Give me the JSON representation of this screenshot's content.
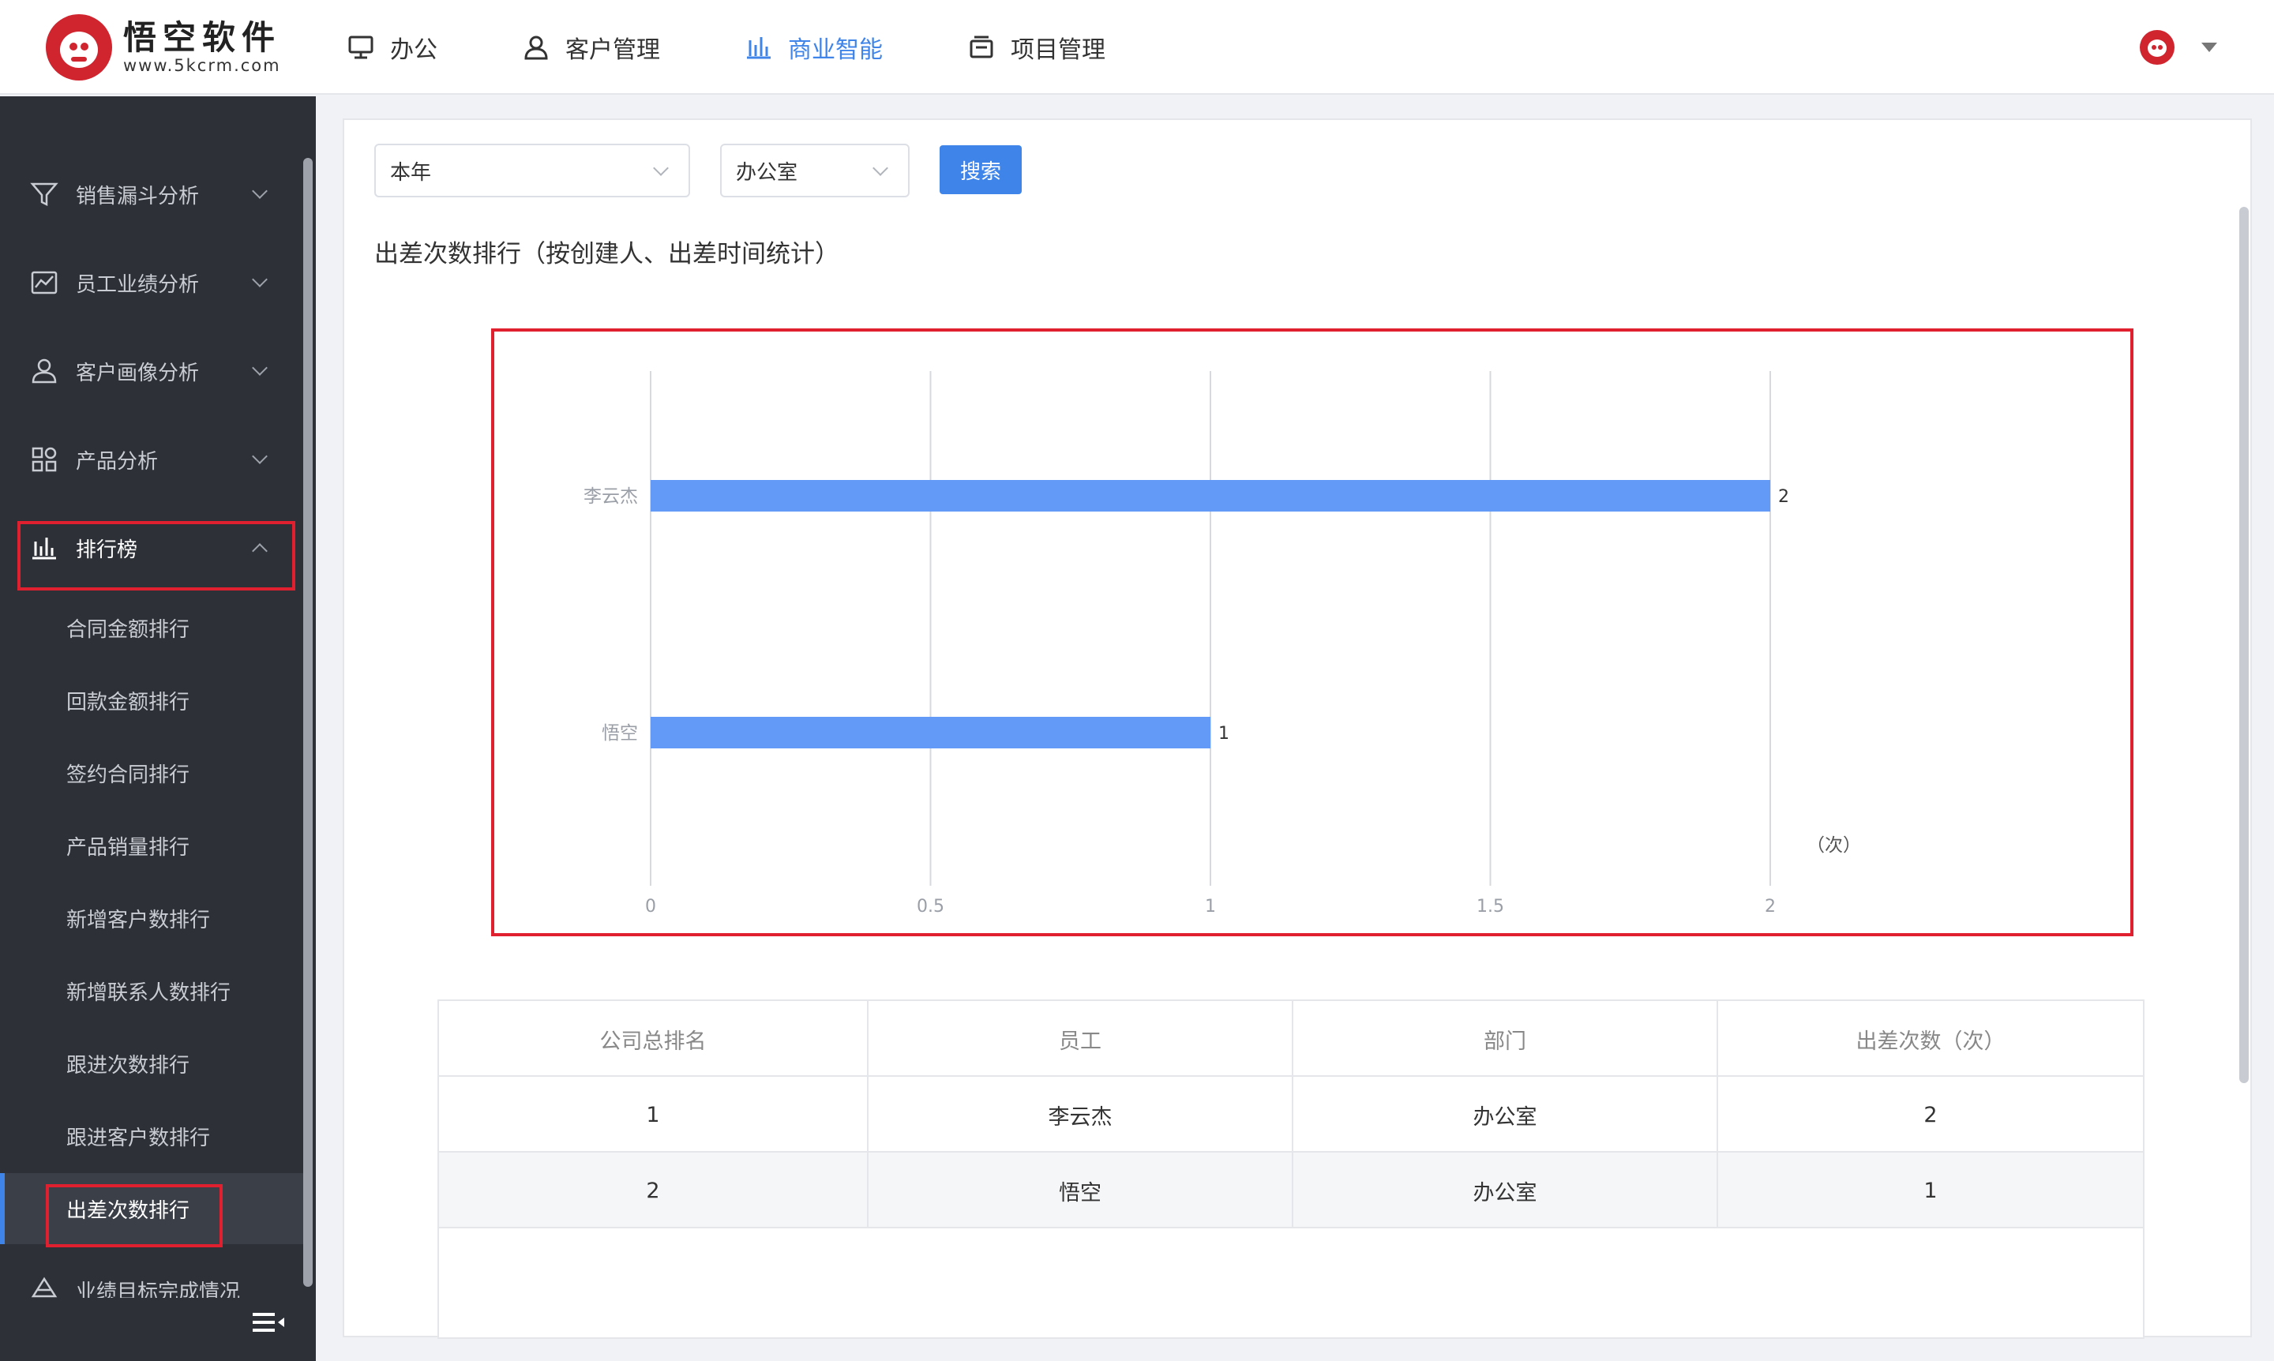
{
  "brand": {
    "name": "悟空软件",
    "url": "www.5kcrm.com"
  },
  "nav": [
    {
      "label": "办公",
      "icon": "monitor-icon",
      "active": false
    },
    {
      "label": "客户管理",
      "icon": "customer-icon",
      "active": false
    },
    {
      "label": "商业智能",
      "icon": "bar-chart-icon",
      "active": true
    },
    {
      "label": "项目管理",
      "icon": "project-icon",
      "active": false
    }
  ],
  "sidebar": {
    "groups": [
      {
        "label": "销售漏斗分析",
        "icon": "funnel-icon"
      },
      {
        "label": "员工业绩分析",
        "icon": "line-chart-icon"
      },
      {
        "label": "客户画像分析",
        "icon": "user-portrait-icon"
      },
      {
        "label": "产品分析",
        "icon": "grid-icon"
      },
      {
        "label": "排行榜",
        "icon": "bar-chart-icon"
      }
    ],
    "ranking_items": [
      "合同金额排行",
      "回款金额排行",
      "签约合同排行",
      "产品销量排行",
      "新增客户数排行",
      "新增联系人数排行",
      "跟进次数排行",
      "跟进客户数排行",
      "出差次数排行"
    ],
    "active_item": "出差次数排行",
    "partial_item": "业绩目标完成情况"
  },
  "filters": {
    "period": "本年",
    "department": "办公室",
    "search_label": "搜索"
  },
  "section_title": "出差次数排行（按创建人、出差时间统计）",
  "chart_data": {
    "type": "bar",
    "orientation": "horizontal",
    "categories": [
      "李云杰",
      "悟空"
    ],
    "values": [
      2,
      1
    ],
    "xlim": [
      0,
      2
    ],
    "x_ticks": [
      "0",
      "0.5",
      "1",
      "1.5",
      "2"
    ],
    "x_unit_label": "（次）",
    "grid": true,
    "bar_color": "#6399f7"
  },
  "table": {
    "headers": [
      "公司总排名",
      "员工",
      "部门",
      "出差次数（次）"
    ],
    "rows": [
      [
        "1",
        "李云杰",
        "办公室",
        "2"
      ],
      [
        "2",
        "悟空",
        "办公室",
        "1"
      ]
    ]
  }
}
